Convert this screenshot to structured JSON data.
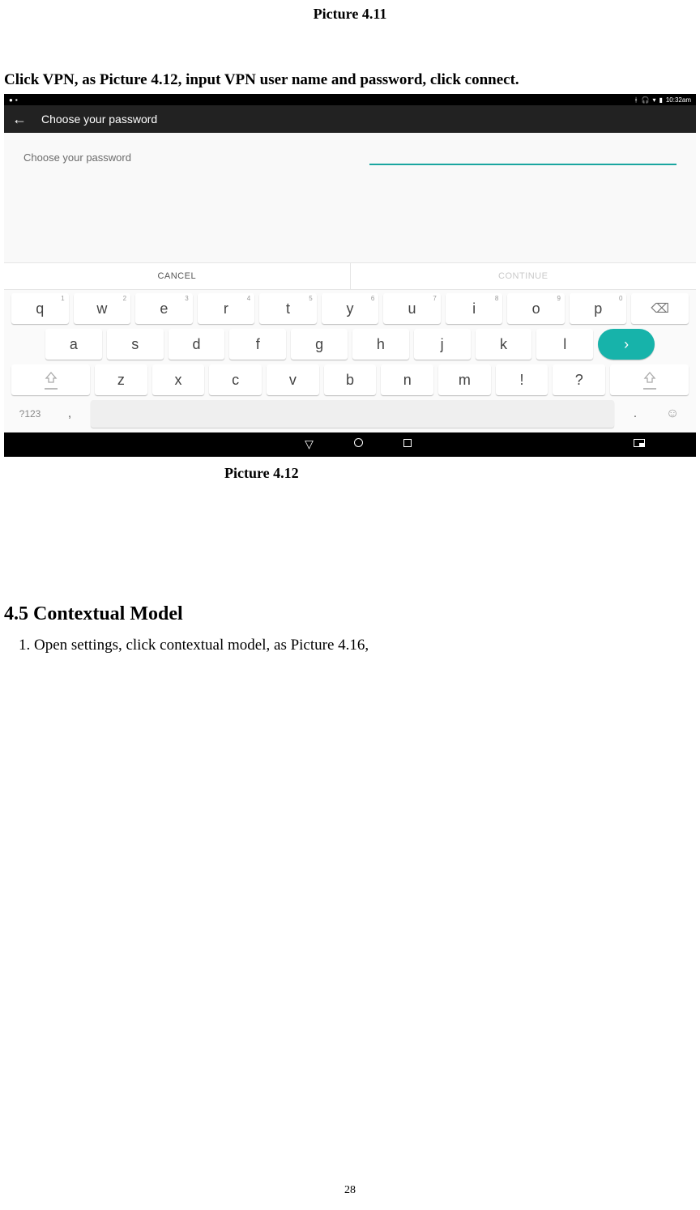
{
  "captions": {
    "top": "Picture 4.11",
    "mid": "Picture 4.12"
  },
  "instruction": "Click VPN, as Picture 4.12, input VPN user name and password, click connect.",
  "statusbar": {
    "time": "10:32am",
    "bluetooth_icon": "bluetooth",
    "headset_icon": "headphones",
    "wifi_icon": "wifi",
    "battery_icon": "battery"
  },
  "header": {
    "back_icon": "←",
    "title": "Choose your password"
  },
  "prompt": "Choose your password",
  "buttons": {
    "cancel": "CANCEL",
    "continue": "CONTINUE"
  },
  "keyboard": {
    "row1": [
      {
        "k": "q",
        "s": "1"
      },
      {
        "k": "w",
        "s": "2"
      },
      {
        "k": "e",
        "s": "3"
      },
      {
        "k": "r",
        "s": "4"
      },
      {
        "k": "t",
        "s": "5"
      },
      {
        "k": "y",
        "s": "6"
      },
      {
        "k": "u",
        "s": "7"
      },
      {
        "k": "i",
        "s": "8"
      },
      {
        "k": "o",
        "s": "9"
      },
      {
        "k": "p",
        "s": "0"
      }
    ],
    "row2": [
      "a",
      "s",
      "d",
      "f",
      "g",
      "h",
      "j",
      "k",
      "l"
    ],
    "row3": [
      "z",
      "x",
      "c",
      "v",
      "b",
      "n",
      "m",
      "!",
      "?"
    ],
    "backspace": "⌫",
    "enter": "›",
    "symkey": "?123",
    "comma": ",",
    "period": ".",
    "emoji": "☺"
  },
  "section": {
    "heading": "4.5 Contextual Model",
    "body": "1. Open settings, click contextual model, as Picture 4.16,"
  },
  "page": "28"
}
